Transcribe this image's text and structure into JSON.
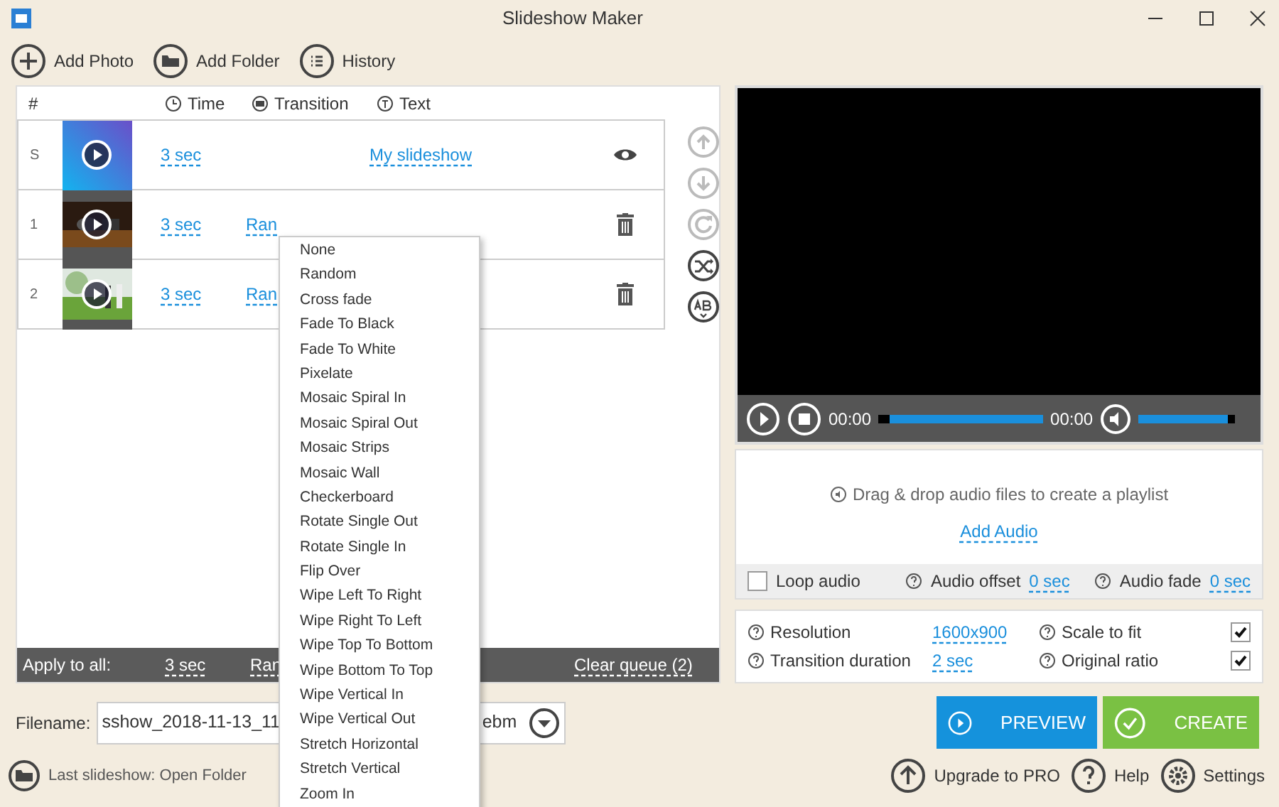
{
  "window": {
    "title": "Slideshow Maker"
  },
  "toolbar": [
    {
      "kind": "add",
      "label": "Add Photo"
    },
    {
      "kind": "folder",
      "label": "Add Folder"
    },
    {
      "kind": "history",
      "label": "History"
    }
  ],
  "queue": {
    "columns": [
      {
        "kind": "number",
        "label": "#"
      },
      {
        "kind": "time",
        "label": "Time"
      },
      {
        "kind": "transition",
        "label": "Transition"
      },
      {
        "kind": "text",
        "label": "Text"
      }
    ],
    "rows": [
      {
        "number": "S",
        "kind": "title",
        "time": "3 sec",
        "text": "My slideshow"
      },
      {
        "number": "1",
        "time": "3 sec",
        "transition": "Ran"
      },
      {
        "number": "2",
        "time": "3 sec",
        "transition": "Ran"
      }
    ],
    "side_buttons": [
      {
        "kind": "up",
        "disabled": true
      },
      {
        "kind": "down",
        "disabled": true
      },
      {
        "kind": "rotate",
        "disabled": true
      },
      {
        "kind": "shuffle",
        "disabled": false
      },
      {
        "kind": "text",
        "disabled": false
      }
    ],
    "apply_all": {
      "label": "Apply to all:",
      "time": "3 sec",
      "transition": "Ran",
      "clear": "Clear queue (2)"
    }
  },
  "filename": {
    "label": "Filename:",
    "value": "sshow_2018-11-13_11",
    "format": "ebm"
  },
  "last_slideshow": "Last slideshow: Open Folder",
  "player": {
    "elapsed": "00:00",
    "total": "00:00",
    "progress": {
      "level": 0
    },
    "volume": {
      "level": 0.93
    }
  },
  "audio": {
    "hint": "Drag & drop audio files to create a playlist",
    "add_link": "Add Audio",
    "loop": {
      "label": "Loop audio",
      "checked": false
    },
    "offset": {
      "label": "Audio offset",
      "value": "0 sec"
    },
    "fade": {
      "label": "Audio fade",
      "value": "0 sec"
    }
  },
  "settings": {
    "resolution": {
      "label": "Resolution",
      "value": "1600x900"
    },
    "transition_duration": {
      "label": "Transition duration",
      "value": "2 sec"
    },
    "scale_to_fit": {
      "label": "Scale to fit",
      "checked": true
    },
    "original_ratio": {
      "label": "Original ratio",
      "checked": true
    }
  },
  "actions": [
    {
      "kind": "preview",
      "label": "PREVIEW"
    },
    {
      "kind": "create",
      "label": "CREATE"
    }
  ],
  "footer": [
    {
      "kind": "upgrade",
      "label": "Upgrade to PRO"
    },
    {
      "kind": "help",
      "label": "Help"
    },
    {
      "kind": "settings",
      "label": "Settings"
    }
  ],
  "transition_menu": [
    "None",
    "Random",
    "Cross fade",
    "Fade To Black",
    "Fade To White",
    "Pixelate",
    "Mosaic Spiral In",
    "Mosaic Spiral Out",
    "Mosaic Strips",
    "Mosaic Wall",
    "Checkerboard",
    "Rotate Single Out",
    "Rotate Single In",
    "Flip Over",
    "Wipe Left To Right",
    "Wipe Right To Left",
    "Wipe Top To Bottom",
    "Wipe Bottom To Top",
    "Wipe Vertical In",
    "Wipe Vertical Out",
    "Stretch Horizontal",
    "Stretch Vertical",
    "Zoom In"
  ]
}
